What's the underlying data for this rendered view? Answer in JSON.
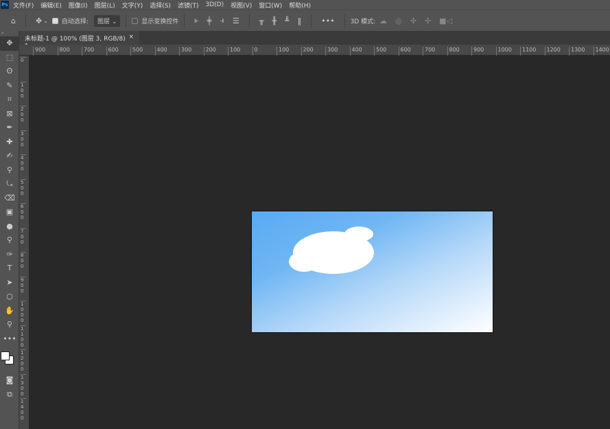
{
  "menu": [
    "文件(F)",
    "编辑(E)",
    "图像(I)",
    "图层(L)",
    "文字(Y)",
    "选择(S)",
    "滤镜(T)",
    "3D(D)",
    "视图(V)",
    "窗口(W)",
    "帮助(H)"
  ],
  "app_logo": "Ps",
  "options": {
    "auto_select_label": "自动选择:",
    "auto_select_checked": true,
    "layer_select": "图层",
    "show_transform_label": "显示变换控件",
    "show_transform_checked": false,
    "more": "•••",
    "mode_3d": "3D 模式:"
  },
  "tab": {
    "title": "未标题-1 @ 100% (图层 3, RGB/8) *",
    "close": "×"
  },
  "hruler": [
    "900",
    "800",
    "700",
    "600",
    "500",
    "400",
    "300",
    "200",
    "100",
    "0",
    "100",
    "200",
    "300",
    "400",
    "500",
    "600",
    "700",
    "800",
    "900",
    "1000",
    "1100",
    "1200",
    "1300",
    "1400"
  ],
  "vruler": [
    "0",
    "100",
    "200",
    "300",
    "400",
    "500",
    "600",
    "700",
    "800",
    "900",
    "1000",
    "1100",
    "1200",
    "1300",
    "1400"
  ],
  "tools": [
    "move",
    "rect-marquee",
    "lasso",
    "quick-select",
    "crop",
    "frame",
    "eyedropper",
    "healing",
    "brush",
    "stamp",
    "history-brush",
    "eraser",
    "gradient",
    "blur",
    "dodge",
    "pen",
    "type",
    "path-select",
    "ellipse",
    "hand",
    "zoom",
    "more"
  ],
  "colors": {
    "accent": "#31a8ff",
    "sky_start": "#58aaf3",
    "sky_end": "#ffffff",
    "foreground": "#ffffff",
    "background": "#ffffff"
  }
}
